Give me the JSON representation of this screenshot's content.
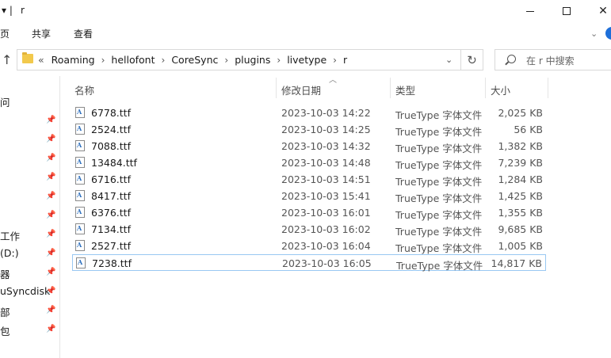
{
  "window": {
    "title": "r",
    "title_prefix": "▾ |",
    "controls": {
      "minimize": "—",
      "maximize": "☐",
      "close": "✕"
    }
  },
  "ribbon": {
    "tabs": [
      "页",
      "共享",
      "查看"
    ]
  },
  "address": {
    "overflow": "«",
    "crumbs": [
      "Roaming",
      "hellofont",
      "CoreSync",
      "plugins",
      "livetype",
      "r"
    ],
    "separator": "›",
    "search_placeholder": "在 r 中搜索"
  },
  "navpane": {
    "items": [
      {
        "label": "问",
        "pinned": false
      },
      {
        "label": "",
        "pinned": true
      },
      {
        "label": "",
        "pinned": true
      },
      {
        "label": "",
        "pinned": true
      },
      {
        "label": "",
        "pinned": true
      },
      {
        "label": "",
        "pinned": true
      },
      {
        "label": "",
        "pinned": true
      },
      {
        "label": "工作",
        "pinned": true
      },
      {
        "label": "(D:)",
        "pinned": true
      },
      {
        "label": "器",
        "pinned": true
      },
      {
        "label": "uSyncdisk",
        "pinned": true
      },
      {
        "label": "部",
        "pinned": true
      },
      {
        "label": "包",
        "pinned": true
      }
    ]
  },
  "columns": {
    "name": "名称",
    "date": "修改日期",
    "type": "类型",
    "size": "大小"
  },
  "files": [
    {
      "name": "6778.ttf",
      "date": "2023-10-03 14:22",
      "type": "TrueType 字体文件",
      "size": "2,025 KB"
    },
    {
      "name": "2524.ttf",
      "date": "2023-10-03 14:25",
      "type": "TrueType 字体文件",
      "size": "56 KB"
    },
    {
      "name": "7088.ttf",
      "date": "2023-10-03 14:32",
      "type": "TrueType 字体文件",
      "size": "1,382 KB"
    },
    {
      "name": "13484.ttf",
      "date": "2023-10-03 14:48",
      "type": "TrueType 字体文件",
      "size": "7,239 KB"
    },
    {
      "name": "6716.ttf",
      "date": "2023-10-03 14:51",
      "type": "TrueType 字体文件",
      "size": "1,284 KB"
    },
    {
      "name": "8417.ttf",
      "date": "2023-10-03 15:41",
      "type": "TrueType 字体文件",
      "size": "1,425 KB"
    },
    {
      "name": "6376.ttf",
      "date": "2023-10-03 16:01",
      "type": "TrueType 字体文件",
      "size": "1,355 KB"
    },
    {
      "name": "7134.ttf",
      "date": "2023-10-03 16:02",
      "type": "TrueType 字体文件",
      "size": "9,685 KB"
    },
    {
      "name": "2527.ttf",
      "date": "2023-10-03 16:04",
      "type": "TrueType 字体文件",
      "size": "1,005 KB"
    },
    {
      "name": "7238.ttf",
      "date": "2023-10-03 16:05",
      "type": "TrueType 字体文件",
      "size": "14,817 KB",
      "selected": true
    }
  ],
  "colors": {
    "selection_border": "#99c8f2",
    "folder": "#f2c94c",
    "help_blue": "#1e6fd9"
  }
}
